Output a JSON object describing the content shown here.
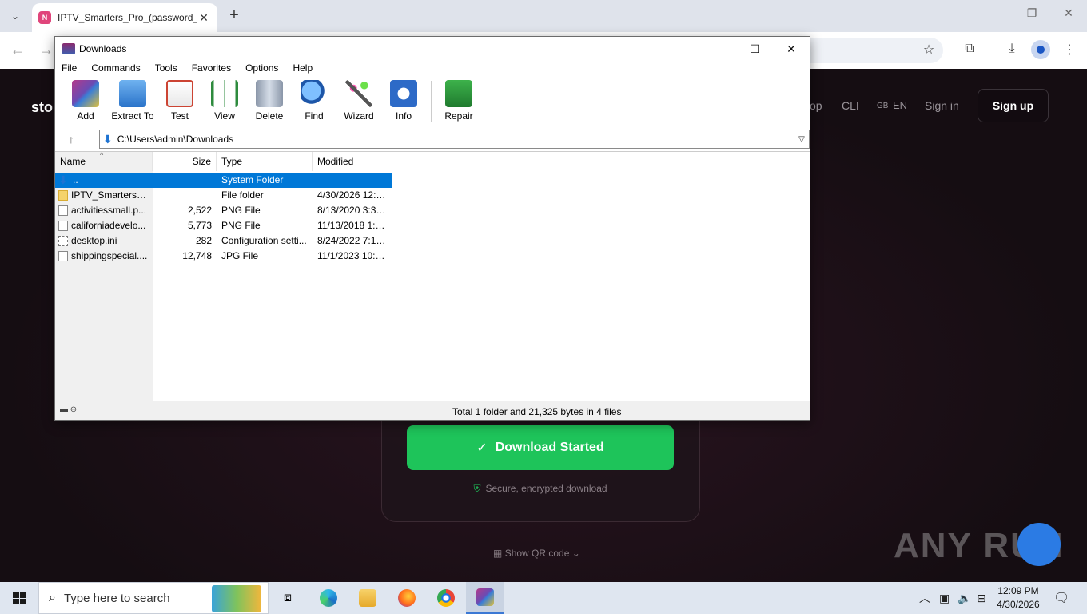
{
  "browser": {
    "tab_title": "IPTV_Smarters_Pro_(password_",
    "tab_favicon_text": "N",
    "new_tab_symbol": "+",
    "minimize": "–",
    "restore": "❐",
    "close": "✕"
  },
  "website": {
    "logo": "sto",
    "nav": [
      "op",
      "CLI",
      "EN",
      "Sign in"
    ],
    "lang_prefix": "GB",
    "signup_label": "Sign up",
    "download_label": "Download Started",
    "secure_text": "Secure, encrypted download",
    "qr_text": "Show QR code",
    "watermark": "ANY RUN"
  },
  "winrar": {
    "title": "Downloads",
    "menu": [
      "File",
      "Commands",
      "Tools",
      "Favorites",
      "Options",
      "Help"
    ],
    "toolbar": [
      "Add",
      "Extract To",
      "Test",
      "View",
      "Delete",
      "Find",
      "Wizard",
      "Info",
      "Repair"
    ],
    "address": "C:\\Users\\admin\\Downloads",
    "columns": {
      "name": "Name",
      "size": "Size",
      "type": "Type",
      "modified": "Modified"
    },
    "rows": [
      {
        "name": "..",
        "size": "",
        "type": "System Folder",
        "modified": "",
        "icon": "up-arrow-icon"
      },
      {
        "name": "IPTV_Smarters_P...",
        "size": "",
        "type": "File folder",
        "modified": "4/30/2026 12:0...",
        "icon": "folder-icon"
      },
      {
        "name": "activitiessmall.p...",
        "size": "2,522",
        "type": "PNG File",
        "modified": "8/13/2020 3:32 ...",
        "icon": "file-icon"
      },
      {
        "name": "californiadevelo...",
        "size": "5,773",
        "type": "PNG File",
        "modified": "11/13/2018 1:4...",
        "icon": "file-icon"
      },
      {
        "name": "desktop.ini",
        "size": "282",
        "type": "Configuration setti...",
        "modified": "8/24/2022 7:10 ...",
        "icon": "settings-file-icon"
      },
      {
        "name": "shippingspecial....",
        "size": "12,748",
        "type": "JPG File",
        "modified": "11/1/2023 10:4...",
        "icon": "file-icon"
      }
    ],
    "status": "Total 1 folder and 21,325 bytes in 4 files"
  },
  "taskbar": {
    "search_placeholder": "Type here to search",
    "time": "12:09 PM",
    "date": "4/30/2026"
  },
  "colors": {
    "accent_green": "#1ec45a",
    "selection_blue": "#0078d7"
  }
}
